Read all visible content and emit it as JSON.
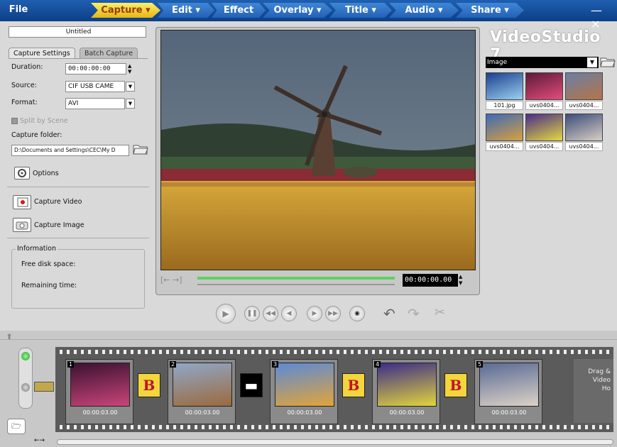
{
  "menu": {
    "file": "File",
    "steps": [
      "Capture",
      "Edit",
      "Effect",
      "Overlay",
      "Title",
      "Audio",
      "Share"
    ],
    "active_step": "Capture",
    "minimize": "—",
    "close": "×"
  },
  "project": {
    "title": "Untitled"
  },
  "capture": {
    "tabs": [
      "Capture Settings",
      "Batch Capture"
    ],
    "duration_label": "Duration:",
    "duration_value": "00:00:00:00",
    "source_label": "Source:",
    "source_value": "CIF USB CAME",
    "format_label": "Format:",
    "format_value": "AVI",
    "split_label": "Split by Scene",
    "folder_label": "Capture folder:",
    "folder_value": "D:\\Documents and Settings\\CEC\\My D",
    "options_label": "Options",
    "capture_video_label": "Capture Video",
    "capture_image_label": "Capture Image",
    "info_title": "Information",
    "free_disk_label": "Free disk space:",
    "remaining_label": "Remaining time:"
  },
  "preview": {
    "timecode": "00:00:00.00"
  },
  "library": {
    "app_title": "VideoStudio 7",
    "category": "Image",
    "items": [
      {
        "name": "101.jpg",
        "colors": [
          "#1a3f8f",
          "#9bd0f0"
        ]
      },
      {
        "name": "uvs0404...",
        "colors": [
          "#5b1a3a",
          "#e34c7a"
        ]
      },
      {
        "name": "uvs0404...",
        "colors": [
          "#6b7fa5",
          "#b57447"
        ]
      },
      {
        "name": "uvs0404...",
        "colors": [
          "#3d6ab7",
          "#d9a03e"
        ]
      },
      {
        "name": "uvs0404...",
        "colors": [
          "#4a2c88",
          "#e3d93f"
        ]
      },
      {
        "name": "uvs0404...",
        "colors": [
          "#3c4c7a",
          "#d8cfc3"
        ]
      }
    ]
  },
  "timeline": {
    "clips": [
      {
        "num": "1",
        "time": "00:00:03.00",
        "colors": [
          "#3a1230",
          "#c9457a"
        ]
      },
      {
        "num": "2",
        "time": "00:00:03.00",
        "colors": [
          "#8fa8c9",
          "#9b6a3c"
        ]
      },
      {
        "num": "3",
        "time": "00:00:03.00",
        "colors": [
          "#5c8ad6",
          "#e2a43a"
        ]
      },
      {
        "num": "4",
        "time": "00:00:03.00",
        "colors": [
          "#3b2d8a",
          "#e3d43c"
        ]
      },
      {
        "num": "5",
        "time": "00:00:03.00",
        "colors": [
          "#5a6b96",
          "#dcd2c6"
        ]
      }
    ],
    "transition_letter": "B",
    "drag_hint": [
      "Drag &",
      "Video",
      "Ho"
    ]
  }
}
